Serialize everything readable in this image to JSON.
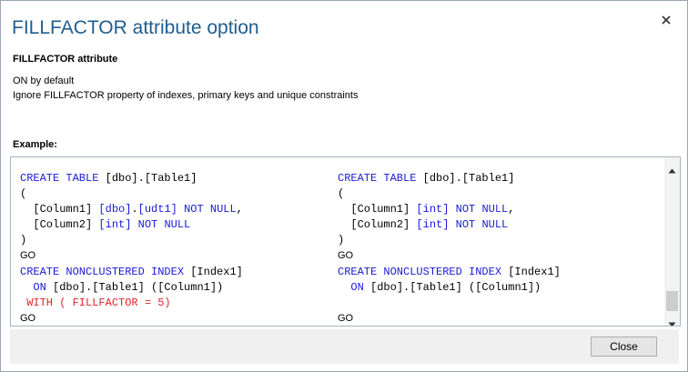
{
  "dialog": {
    "title": "FILLFACTOR attribute option",
    "section_label": "FILLFACTOR attribute",
    "description_lines": [
      "ON by default",
      "Ignore FILLFACTOR property of indexes, primary keys and unique constraints"
    ],
    "example_label": "Example:",
    "close_button_label": "Close",
    "icons": {
      "close": "close-icon",
      "scroll_up": "scroll-up-arrow-icon",
      "scroll_down": "scroll-down-arrow-icon"
    }
  },
  "colors": {
    "title": "#1f5d8f",
    "keyword": "#1a1ad6",
    "highlight": "#e0242a",
    "footer": "#f0f0f0"
  },
  "code": {
    "left": [
      [
        {
          "t": "CREATE TABLE",
          "c": "kw"
        },
        {
          "t": " [dbo].[Table1]"
        }
      ],
      [
        {
          "t": "("
        }
      ],
      [
        {
          "t": "  [Column1] "
        },
        {
          "t": "[dbo]",
          "c": "kw"
        },
        {
          "t": "."
        },
        {
          "t": "[udt1]",
          "c": "kw"
        },
        {
          "t": " "
        },
        {
          "t": "NOT NULL",
          "c": "kw"
        },
        {
          "t": ","
        }
      ],
      [
        {
          "t": "  [Column2] "
        },
        {
          "t": "[int]",
          "c": "kw"
        },
        {
          "t": " "
        },
        {
          "t": "NOT NULL",
          "c": "kw"
        }
      ],
      [
        {
          "t": ")"
        }
      ],
      [
        {
          "t": "GO",
          "c": "go"
        }
      ],
      [
        {
          "t": "CREATE NONCLUSTERED INDEX",
          "c": "kw"
        },
        {
          "t": " [Index1]"
        }
      ],
      [
        {
          "t": "  "
        },
        {
          "t": "ON",
          "c": "kw"
        },
        {
          "t": " [dbo].[Table1] ([Column1])"
        }
      ],
      [
        {
          "t": " WITH ( FILLFACTOR = 5)",
          "c": "red"
        }
      ],
      [
        {
          "t": "GO",
          "c": "go"
        }
      ]
    ],
    "right": [
      [
        {
          "t": "CREATE TABLE",
          "c": "kw"
        },
        {
          "t": " [dbo].[Table1]"
        }
      ],
      [
        {
          "t": "("
        }
      ],
      [
        {
          "t": "  [Column1] "
        },
        {
          "t": "[int]",
          "c": "kw"
        },
        {
          "t": " "
        },
        {
          "t": "NOT NULL",
          "c": "kw"
        },
        {
          "t": ","
        }
      ],
      [
        {
          "t": "  [Column2] "
        },
        {
          "t": "[int]",
          "c": "kw"
        },
        {
          "t": " "
        },
        {
          "t": "NOT NULL",
          "c": "kw"
        }
      ],
      [
        {
          "t": ")"
        }
      ],
      [
        {
          "t": "GO",
          "c": "go"
        }
      ],
      [
        {
          "t": "CREATE NONCLUSTERED INDEX",
          "c": "kw"
        },
        {
          "t": " [Index1]"
        }
      ],
      [
        {
          "t": "  "
        },
        {
          "t": "ON",
          "c": "kw"
        },
        {
          "t": " [dbo].[Table1] ([Column1])"
        }
      ],
      [
        {
          "t": ""
        }
      ],
      [
        {
          "t": "GO",
          "c": "go"
        }
      ]
    ]
  }
}
